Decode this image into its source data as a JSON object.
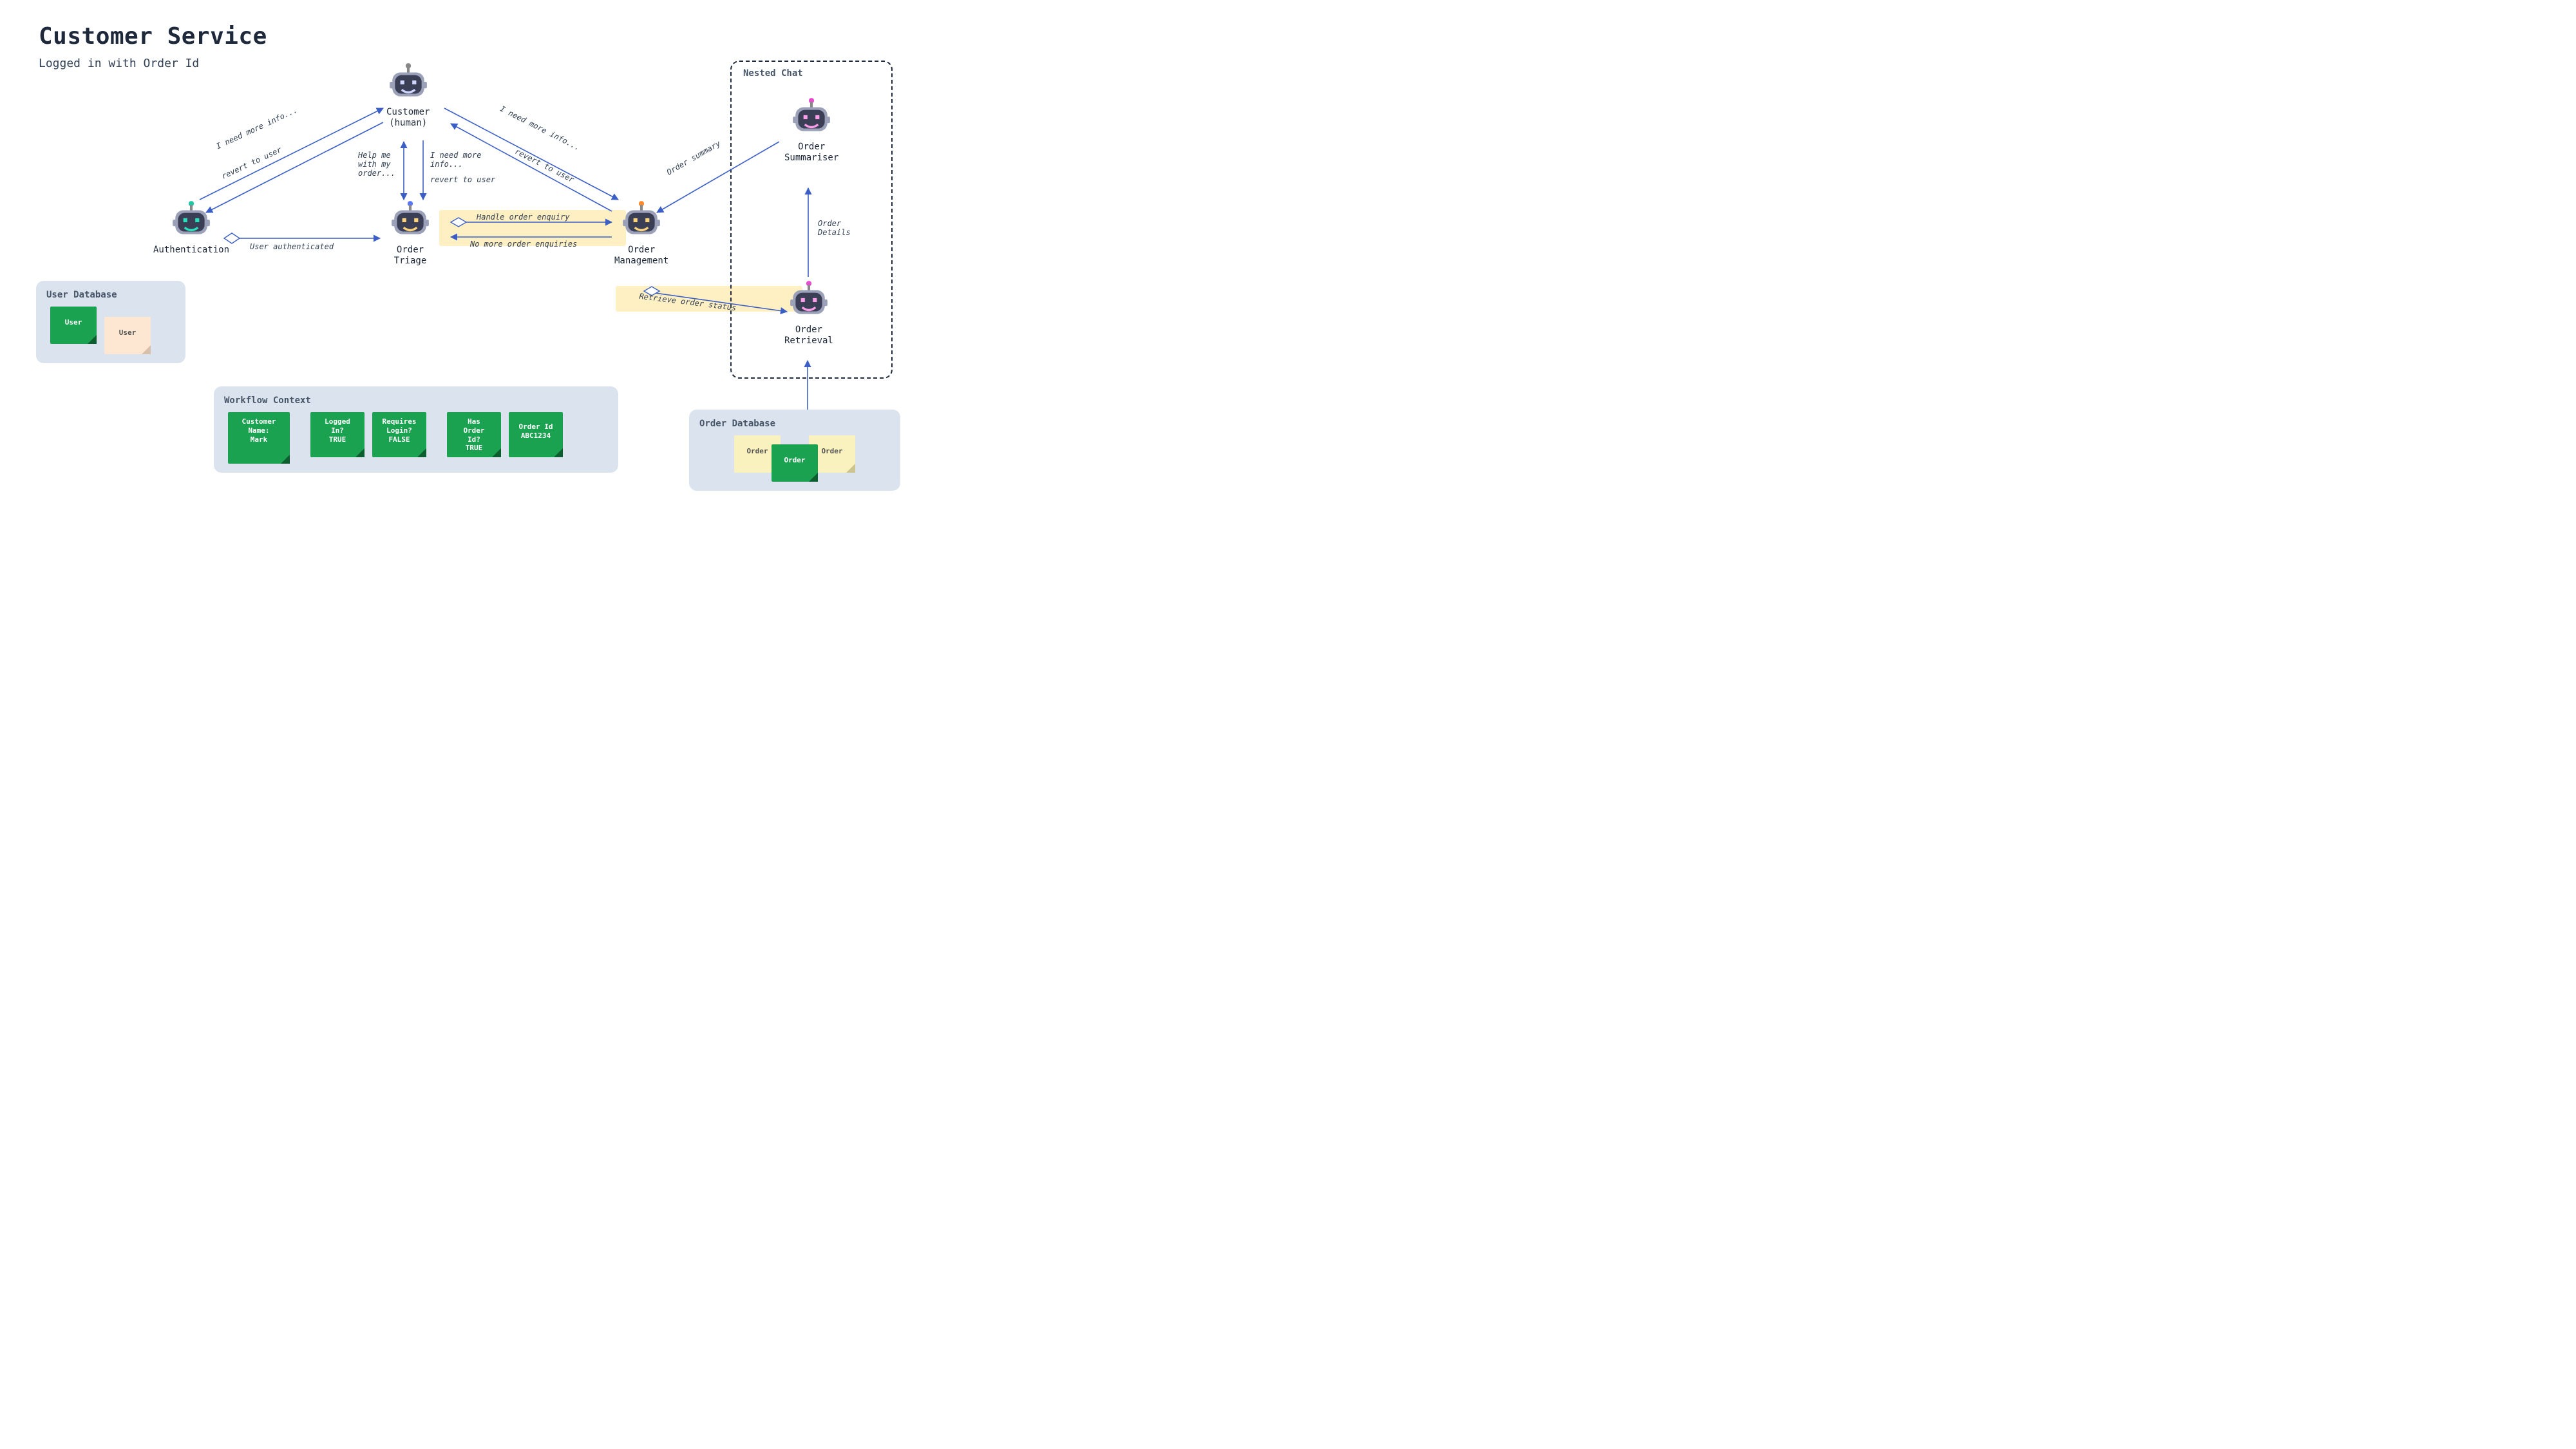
{
  "title": "Customer Service",
  "subtitle": "Logged in with Order Id",
  "agents": {
    "customer": "Customer\n(human)",
    "auth": "Authentication",
    "triage": "Order\nTriage",
    "mgmt": "Order\nManagement",
    "summariser": "Order\nSummariser",
    "retrieval": "Order\nRetrieval"
  },
  "nested_title": "Nested Chat",
  "edges": {
    "auth_customer_1": "I need more info...",
    "auth_customer_2": "revert to user",
    "triage_customer_1": "Help me\nwith my\norder...",
    "triage_customer_2": "I need more\ninfo...",
    "triage_customer_3": "revert to user",
    "mgmt_customer_1": "I need more info...",
    "mgmt_customer_2": "revert to user",
    "auth_triage": "User authenticated",
    "triage_mgmt_1": "Handle order enquiry",
    "triage_mgmt_2": "No more order enquiries",
    "mgmt_retrieval": "Retrieve order status",
    "retrieval_summariser": "Order\nDetails",
    "summariser_mgmt": "Order summary"
  },
  "user_db": {
    "title": "User Database",
    "notes": [
      "User",
      "User"
    ]
  },
  "workflow": {
    "title": "Workflow Context",
    "notes": [
      "Customer\nName:\nMark",
      "Logged\nIn?\nTRUE",
      "Requires\nLogin?\nFALSE",
      "Has\nOrder\nId?\nTRUE",
      "Order Id\nABC1234"
    ]
  },
  "order_db": {
    "title": "Order Database",
    "notes": [
      "Order",
      "Order",
      "Order"
    ]
  }
}
